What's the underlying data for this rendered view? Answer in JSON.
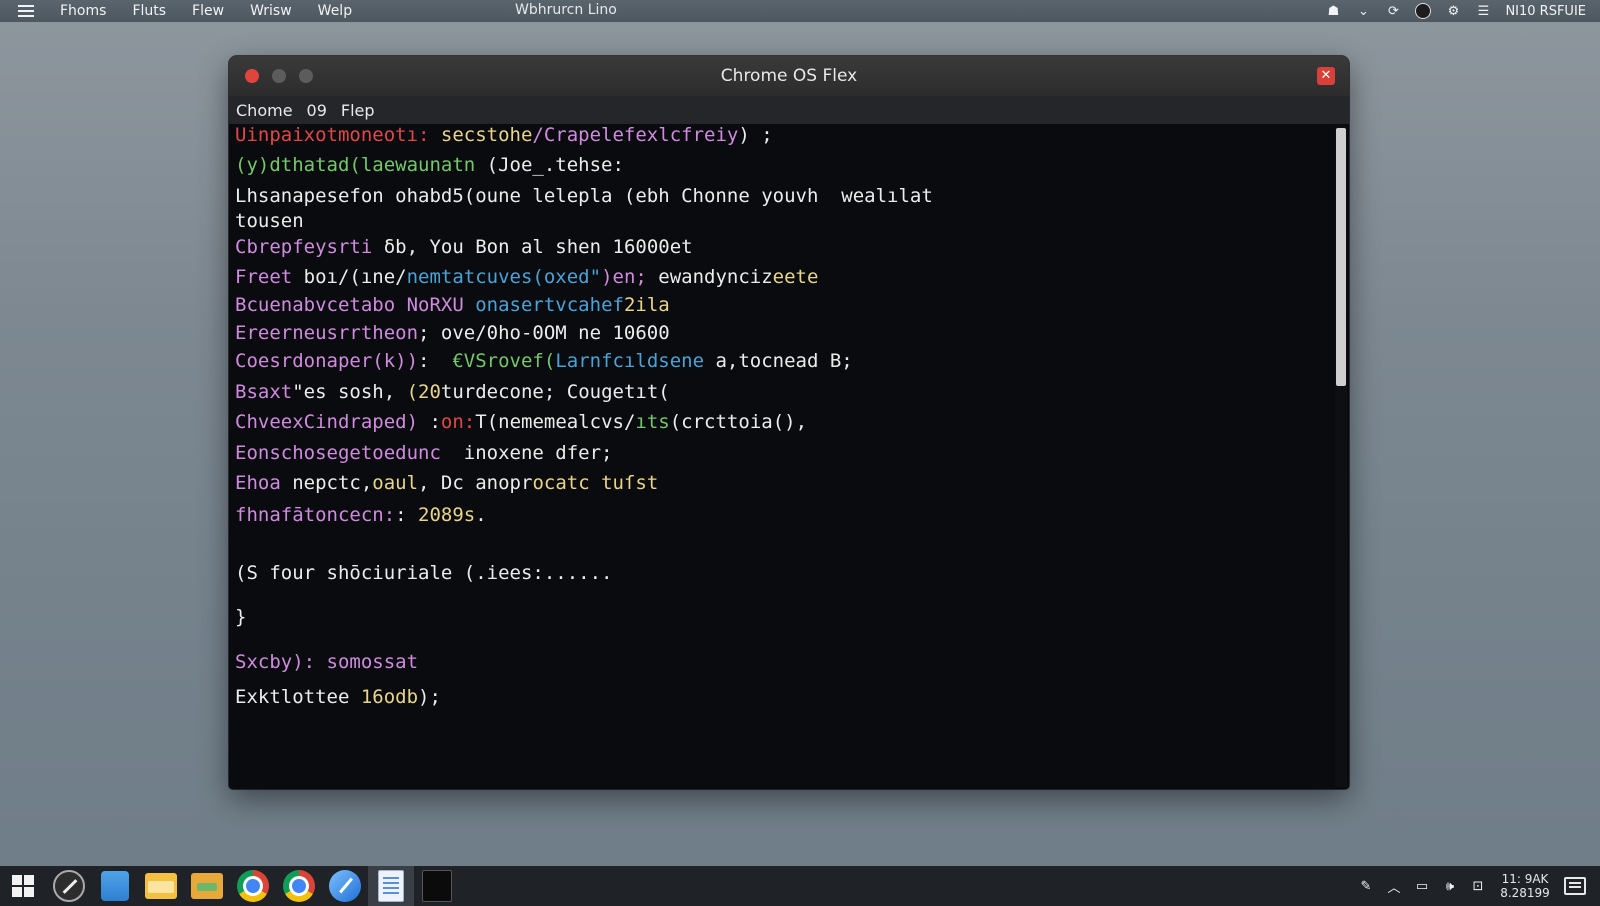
{
  "topbar": {
    "menus": [
      "Fhoms",
      "Fluts",
      "Flew",
      "Wrisw",
      "Welp"
    ],
    "center_title": "Wbhrurcn Lino",
    "right_label": "NI10 RSFUIE"
  },
  "window": {
    "title": "Chrome OS Flex",
    "app_menus": [
      "Chome",
      "09",
      "Flep"
    ]
  },
  "terminal": {
    "lines": [
      {
        "segments": [
          {
            "text": "Uinpaixotmoneotı: ",
            "color": "red"
          },
          {
            "text": "secstohe",
            "color": "yellow"
          },
          {
            "text": "/Crapelefexlcfreiy",
            "color": "purple"
          },
          {
            "text": ") ;",
            "color": "white"
          }
        ]
      },
      {
        "segments": [
          {
            "text": "(y)dthatad(laewaunatn",
            "color": "green"
          },
          {
            "text": " (Joe_.tehse:",
            "color": "white"
          }
        ]
      },
      {
        "segments": [
          {
            "text": "Lhsanapesefon ohabd5(oune lelepla (ebh Chonne youvh  wealılat",
            "color": "white"
          }
        ]
      },
      {
        "segments": [
          {
            "text": "tousen",
            "color": "white"
          }
        ]
      },
      {
        "segments": [
          {
            "text": "Cbrepfeysrti",
            "color": "purple"
          },
          {
            "text": " δb, You Bon al shen 16000et",
            "color": "white"
          }
        ]
      },
      {
        "segments": [
          {
            "text": "Freet",
            "color": "purple"
          },
          {
            "text": " boı/(ıne/",
            "color": "white"
          },
          {
            "text": "nemtatcuves(oxed\"",
            "color": "blue"
          },
          {
            "text": ")en; ",
            "color": "purple"
          },
          {
            "text": "ewandynciz",
            "color": "white"
          },
          {
            "text": "eete",
            "color": "yellow"
          }
        ]
      },
      {
        "segments": [
          {
            "text": "Bcuenabvcetabo",
            "color": "purple"
          },
          {
            "text": " NoRXU ",
            "color": "purple"
          },
          {
            "text": "onasertvcahef",
            "color": "blue"
          },
          {
            "text": "2ila",
            "color": "yellow"
          }
        ]
      },
      {
        "segments": [
          {
            "text": "Ereerneusrrtheon",
            "color": "purple"
          },
          {
            "text": "; ove/0ho-0OM ne 10600",
            "color": "white"
          }
        ]
      },
      {
        "segments": [
          {
            "text": "Coesrdonaper(k))",
            "color": "purple"
          },
          {
            "text": ":  ",
            "color": "white"
          },
          {
            "text": "€VSrovef(",
            "color": "green"
          },
          {
            "text": "Larnfcıldsene",
            "color": "blue"
          },
          {
            "text": " a,tocnead B;",
            "color": "white"
          }
        ]
      },
      {
        "segments": [
          {
            "text": "Bsaxt",
            "color": "purple"
          },
          {
            "text": "\"es sosh, ",
            "color": "white"
          },
          {
            "text": "(20",
            "color": "yellow"
          },
          {
            "text": "turdecone; Cougetıt(",
            "color": "white"
          }
        ]
      },
      {
        "segments": [
          {
            "text": "ChveexCindraped)",
            "color": "purple"
          },
          {
            "text": " :",
            "color": "white"
          },
          {
            "text": "on:",
            "color": "red"
          },
          {
            "text": "T(nememe",
            "color": "white"
          },
          {
            "text": "alcvs/",
            "color": "white"
          },
          {
            "text": "ıts",
            "color": "green"
          },
          {
            "text": "(crctto",
            "color": "white"
          },
          {
            "text": "ia(),",
            "color": "white"
          }
        ]
      },
      {
        "segments": [
          {
            "text": "Eonschosegetoedunc",
            "color": "purple"
          },
          {
            "text": "  inoxene dfer;",
            "color": "white"
          }
        ]
      },
      {
        "segments": [
          {
            "text": "Ehoa",
            "color": "purple"
          },
          {
            "text": " nepctc,",
            "color": "white"
          },
          {
            "text": "oaul",
            "color": "yellow"
          },
          {
            "text": ", Dc anopr",
            "color": "white"
          },
          {
            "text": "ocatc tuſst",
            "color": "yellow"
          }
        ]
      },
      {
        "segments": [
          {
            "text": "fhnafātoncecn:",
            "color": "purple"
          },
          {
            "text": ": ",
            "color": "white"
          },
          {
            "text": "2089s",
            "color": "yellow"
          },
          {
            "text": ".",
            "color": "white"
          }
        ]
      },
      {
        "segments": [
          {
            "text": "(S four shōciuriale (.iees:......",
            "color": "white"
          }
        ]
      },
      {
        "segments": [
          {
            "text": "}",
            "color": "white"
          }
        ]
      },
      {
        "segments": [
          {
            "text": "Sxcby): ",
            "color": "purple"
          },
          {
            "text": "somossat",
            "color": "purple"
          }
        ]
      },
      {
        "segments": [
          {
            "text": "Exktlottee ",
            "color": "white"
          },
          {
            "text": "16odb",
            "color": "yellow"
          },
          {
            "text": ");",
            "color": "white"
          }
        ]
      }
    ]
  },
  "taskbar": {
    "apps": [
      "start-icon",
      "compass-icon",
      "mail-icon",
      "files-icon",
      "folder-icon",
      "chrome-icon",
      "chrome-icon",
      "feather-icon",
      "document-icon",
      "terminal-icon"
    ],
    "clock_time": "11: 9AK",
    "clock_date": "8.28199"
  },
  "colors": {
    "red": "#e04848",
    "green": "#74c86a",
    "purple": "#d08ae0",
    "blue": "#4aa3d8",
    "yellow": "#e9d58a",
    "white": "#ececec"
  }
}
